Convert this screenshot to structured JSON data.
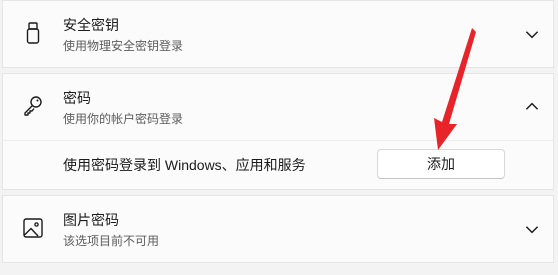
{
  "security_key": {
    "title": "安全密钥",
    "subtitle": "使用物理安全密钥登录",
    "icon": "usb-key-icon"
  },
  "password": {
    "title": "密码",
    "subtitle": "使用你的帐户密码登录",
    "icon": "key-icon",
    "expanded": true,
    "action_label": "使用密码登录到 Windows、应用和服务",
    "add_button": "添加"
  },
  "picture_password": {
    "title": "图片密码",
    "subtitle": "该选项目前不可用",
    "icon": "picture-icon"
  },
  "annotation": {
    "arrow_color": "#e8242a"
  }
}
